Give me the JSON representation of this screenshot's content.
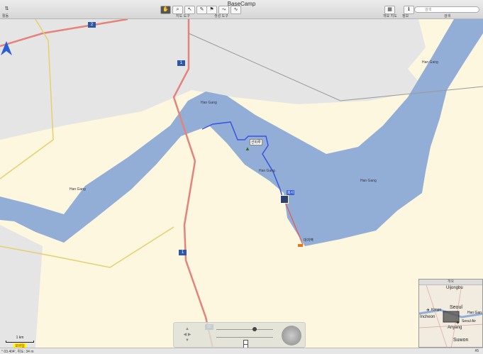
{
  "window": {
    "title": "BaseCamp"
  },
  "toolbar": {
    "left_label": "활동",
    "map_tools_label": "지도 도구",
    "route_tools_label": "생성 도구",
    "map_toggle_label": "개요 지도",
    "info_label": "정보",
    "search_label": "검색",
    "search_placeholder": "검색"
  },
  "map": {
    "water_labels": [
      "Han Gang",
      "Han Gang",
      "Han Gang",
      "Han Gang",
      "Han Gang"
    ],
    "road_shields": [
      "2",
      "1",
      "1"
    ],
    "waypoints": [
      {
        "label": "선따루",
        "icon": "summit-icon"
      },
      {
        "label": "회사",
        "icon": "building-icon"
      },
      {
        "label": "대치역",
        "icon": "car-icon"
      }
    ],
    "shield_bottom": "88"
  },
  "scale": {
    "distance": "1 km",
    "label": "모바일"
  },
  "overview": {
    "title": "개요",
    "places": [
      "Uijongbu",
      "Seoul",
      "Kimpo",
      "Incheon",
      "Han Gan",
      "Seoul Air",
      "Anyang",
      "Suwon"
    ]
  },
  "status": {
    "coords": "° 03.404', 위도: 34 m",
    "zoom": "#5"
  },
  "colors": {
    "water": "#93aed6",
    "land": "#fdf7df",
    "gray_land": "#e5e5e5",
    "road_red": "#e48379",
    "road_yellow": "#e6cf6c"
  }
}
